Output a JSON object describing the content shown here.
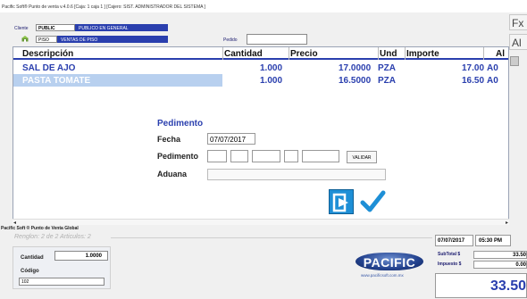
{
  "window": {
    "title": "Pacific Soft® Punto de venta v.4.0.6   [Caja: 1 caja 1 ]   [Cajero: SIST. ADMINISTRADOR DEL SISTEMA ]"
  },
  "client": {
    "label": "Cliente",
    "code": "PUBLIC",
    "name": "PUBLICO EN GENERAL",
    "floor_code": "PISO",
    "floor_name": "VENTAS DE PISO",
    "pedido_label": "Pedido",
    "pedido_value": ""
  },
  "side_buttons": [
    "Fx",
    "Al"
  ],
  "grid": {
    "columns": [
      "Descripción",
      "Cantidad",
      "Precio",
      "Und",
      "Importe",
      "Al"
    ],
    "rows": [
      {
        "descripcion": "SAL DE AJO",
        "cantidad": "1.000",
        "precio": "17.0000",
        "und": "PZA",
        "importe": "17.00",
        "al": "A0"
      },
      {
        "descripcion": "PASTA TOMATE",
        "cantidad": "1.000",
        "precio": "16.5000",
        "und": "PZA",
        "importe": "16.50",
        "al": "A0"
      }
    ]
  },
  "pedimento": {
    "title": "Pedimento",
    "fecha_label": "Fecha",
    "fecha_value": "07/07/2017",
    "pedimento_label": "Pedimento",
    "validar_label": "VALIDAR",
    "aduana_label": "Aduana",
    "aduana_value": ""
  },
  "footer": {
    "brand": "Pacific Soft ® Punto de Venta Global",
    "status": "Renglon: 2 de 2    Articulos: 2",
    "cantidad_label": "Cantidad",
    "cantidad_value": "1.0000",
    "codigo_label": "Código",
    "codigo_value": "102",
    "logo_text": "PACIFIC",
    "logo_url": "www.pacificsoft.com.mx",
    "date": "07/07/2017",
    "time": "05:30 PM",
    "subtotal_label": "SubTotal  $",
    "subtotal_value": "33.50",
    "impuesto_label": "Impuesto $",
    "impuesto_value": "0.00",
    "total_value": "33.50"
  },
  "colors": {
    "accent_blue": "#2a3fae",
    "selection": "#b8d0ef",
    "exit_button": "#1e8fd6",
    "check": "#1e8fd6"
  }
}
